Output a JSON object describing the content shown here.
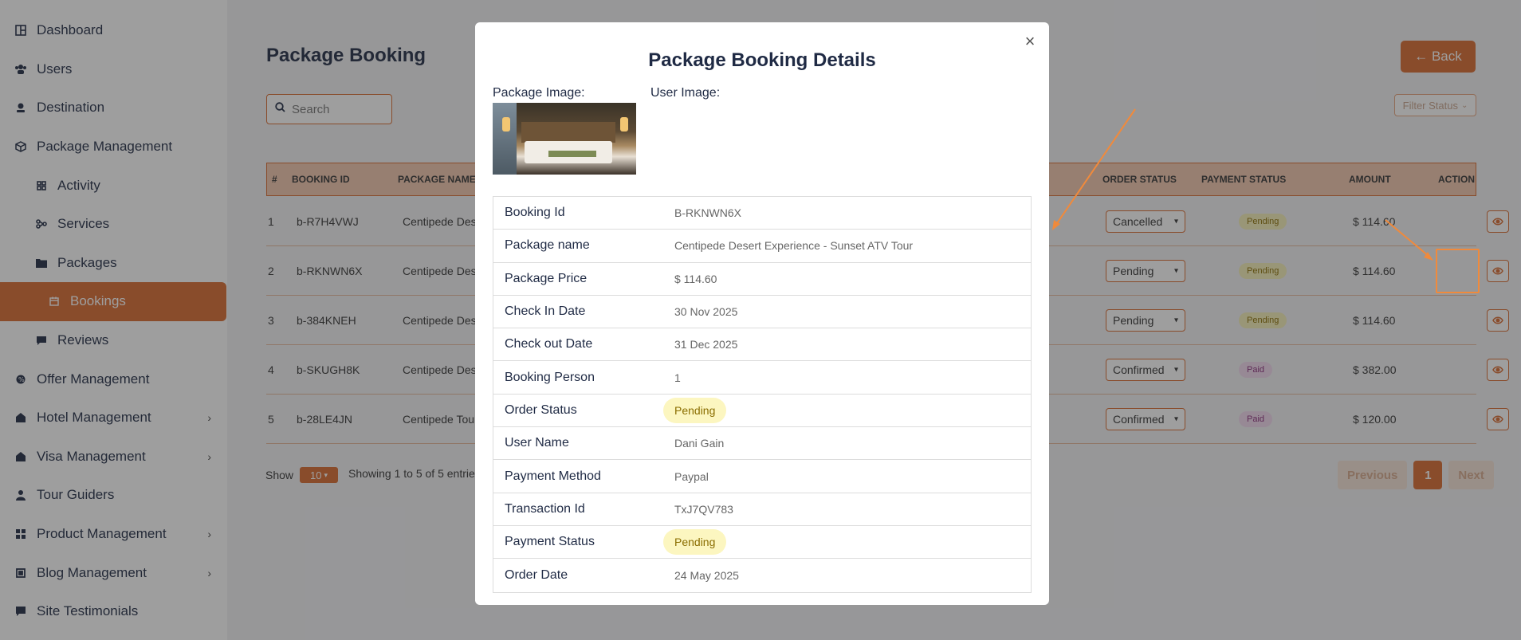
{
  "sidebar": {
    "items": [
      {
        "label": "Dashboard",
        "icon": "grid-icon"
      },
      {
        "label": "Users",
        "icon": "users-icon"
      },
      {
        "label": "Destination",
        "icon": "pin-icon"
      },
      {
        "label": "Package Management",
        "icon": "box-icon"
      },
      {
        "label": "Activity",
        "icon": "activity-icon"
      },
      {
        "label": "Services",
        "icon": "services-icon"
      },
      {
        "label": "Packages",
        "icon": "folder-icon"
      },
      {
        "label": "Bookings",
        "icon": "calendar-icon"
      },
      {
        "label": "Reviews",
        "icon": "chat-icon"
      },
      {
        "label": "Offer Management",
        "icon": "offer-icon"
      },
      {
        "label": "Hotel Management",
        "icon": "hotel-icon"
      },
      {
        "label": "Visa Management",
        "icon": "visa-icon"
      },
      {
        "label": "Tour Guiders",
        "icon": "user-icon"
      },
      {
        "label": "Product Management",
        "icon": "product-icon"
      },
      {
        "label": "Blog Management",
        "icon": "blog-icon"
      },
      {
        "label": "Site Testimonials",
        "icon": "testimonial-icon"
      }
    ]
  },
  "page": {
    "title": "Package Booking",
    "back_label": "← Back",
    "search_placeholder": "Search",
    "filter_label": "Filter Status"
  },
  "table": {
    "headers": [
      "#",
      "BOOKING ID",
      "PACKAGE NAME",
      "ORDER STATUS",
      "PAYMENT STATUS",
      "AMOUNT",
      "ACTION"
    ],
    "rows": [
      {
        "num": "1",
        "id": "b-R7H4VWJ",
        "pkg": "Centipede Dese",
        "status": "Cancelled",
        "pay": "Pending",
        "amount": "$ 114.60"
      },
      {
        "num": "2",
        "id": "b-RKNWN6X",
        "pkg": "Centipede Dese",
        "status": "Pending",
        "pay": "Pending",
        "amount": "$ 114.60"
      },
      {
        "num": "3",
        "id": "b-384KNEH",
        "pkg": "Centipede Dese",
        "status": "Pending",
        "pay": "Pending",
        "amount": "$ 114.60"
      },
      {
        "num": "4",
        "id": "b-SKUGH8K",
        "pkg": "Centipede Dese",
        "status": "Confirmed",
        "pay": "Paid",
        "amount": "$ 382.00"
      },
      {
        "num": "5",
        "id": "b-28LE4JN",
        "pkg": "Centipede Tour",
        "status": "Confirmed",
        "pay": "Paid",
        "amount": "$ 120.00"
      }
    ]
  },
  "footer": {
    "show_label": "Show",
    "page_size": "10",
    "info": "Showing 1 to 5 of 5 entries",
    "prev": "Previous",
    "page": "1",
    "next": "Next"
  },
  "modal": {
    "title": "Package Booking Details",
    "package_image_label": "Package Image:",
    "user_image_label": "User Image:",
    "details": [
      {
        "key": "Booking Id",
        "value": "B-RKNWN6X"
      },
      {
        "key": "Package name",
        "value": "Centipede Desert Experience - Sunset ATV Tour"
      },
      {
        "key": "Package Price",
        "value": "$ 114.60"
      },
      {
        "key": "Check In Date",
        "value": "30 Nov 2025"
      },
      {
        "key": "Check out Date",
        "value": "31 Dec 2025"
      },
      {
        "key": "Booking Person",
        "value": "1"
      },
      {
        "key": "Order Status",
        "value": "Pending"
      },
      {
        "key": "User Name",
        "value": "Dani Gain"
      },
      {
        "key": "Payment Method",
        "value": "Paypal"
      },
      {
        "key": "Transaction Id",
        "value": "TxJ7QV783"
      },
      {
        "key": "Payment Status",
        "value": "Pending"
      },
      {
        "key": "Order Date",
        "value": "24 May 2025"
      }
    ]
  },
  "colors": {
    "accent": "#d96a2f",
    "pending_badge": "#fcf6c0",
    "paid_badge": "#f3d9ee"
  }
}
